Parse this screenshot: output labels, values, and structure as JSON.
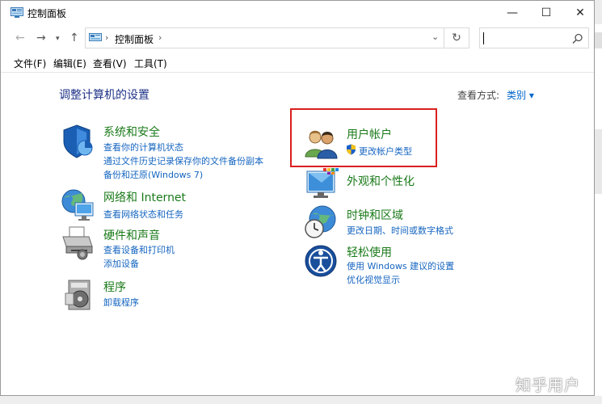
{
  "window": {
    "title": "控制面板",
    "minimize": "—",
    "maximize": "☐",
    "close": "✕"
  },
  "address_bar": {
    "breadcrumb": "控制面板"
  },
  "menu": {
    "file": "文件(F)",
    "edit": "编辑(E)",
    "view": "查看(V)",
    "tools": "工具(T)"
  },
  "main": {
    "heading": "调整计算机的设置",
    "view_by_label": "查看方式:",
    "view_by_value": "类别 ▾"
  },
  "categories": {
    "system": {
      "title": "系统和安全",
      "links": [
        "查看你的计算机状态",
        "通过文件历史记录保存你的文件备份副本",
        "备份和还原(Windows 7)"
      ]
    },
    "network": {
      "title": "网络和 Internet",
      "links": [
        "查看网络状态和任务"
      ]
    },
    "hardware": {
      "title": "硬件和声音",
      "links": [
        "查看设备和打印机",
        "添加设备"
      ]
    },
    "programs": {
      "title": "程序",
      "links": [
        "卸载程序"
      ]
    },
    "accounts": {
      "title": "用户帐户",
      "links": [
        "更改帐户类型"
      ]
    },
    "appearance": {
      "title": "外观和个性化",
      "links": []
    },
    "clock": {
      "title": "时钟和区域",
      "links": [
        "更改日期、时间或数字格式"
      ]
    },
    "ease": {
      "title": "轻松使用",
      "links": [
        "使用 Windows 建议的设置",
        "优化视觉显示"
      ]
    }
  },
  "watermark": "知乎用户"
}
